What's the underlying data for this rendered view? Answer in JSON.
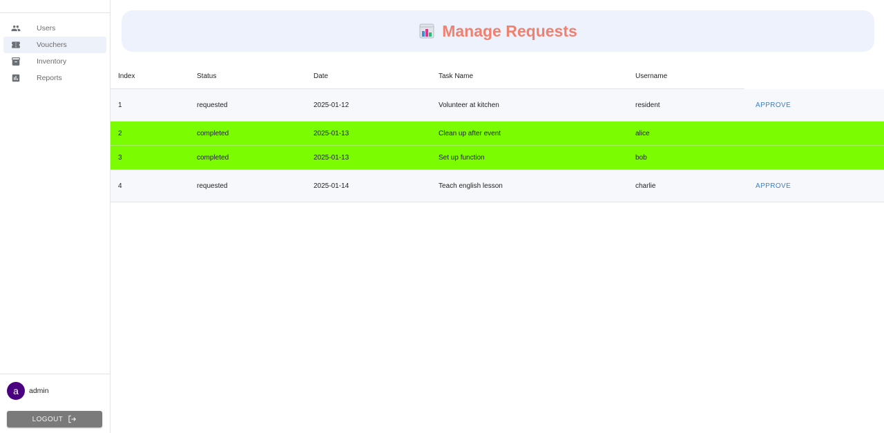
{
  "sidebar": {
    "items": [
      {
        "label": "Users",
        "icon": "people-icon",
        "active": false
      },
      {
        "label": "Vouchers",
        "icon": "ticket-icon",
        "active": true
      },
      {
        "label": "Inventory",
        "icon": "archive-icon",
        "active": false
      },
      {
        "label": "Reports",
        "icon": "bar-chart-icon",
        "active": false
      }
    ],
    "user": {
      "avatar_letter": "a",
      "name": "admin"
    },
    "logout_label": "LOGOUT"
  },
  "header": {
    "title": "Manage Requests",
    "icon": "bar-chart-emoji-icon"
  },
  "table": {
    "columns": [
      "Index",
      "Status",
      "Date",
      "Task Name",
      "Username"
    ],
    "rows": [
      {
        "index": "1",
        "status": "requested",
        "date": "2025-01-12",
        "task": "Volunteer at kitchen",
        "username": "resident",
        "action": "APPROVE"
      },
      {
        "index": "2",
        "status": "completed",
        "date": "2025-01-13",
        "task": "Clean up after event",
        "username": "alice",
        "action": ""
      },
      {
        "index": "3",
        "status": "completed",
        "date": "2025-01-13",
        "task": "Set up function",
        "username": "bob",
        "action": ""
      },
      {
        "index": "4",
        "status": "requested",
        "date": "2025-01-14",
        "task": "Teach english lesson",
        "username": "charlie",
        "action": "APPROVE"
      }
    ]
  },
  "colors": {
    "title": "#f08070",
    "completed_row": "#7cfc00",
    "requested_row": "#f7f8fc",
    "approve": "#3f7fc0",
    "avatar": "#4b0082",
    "header_banner": "#edf2fc"
  }
}
